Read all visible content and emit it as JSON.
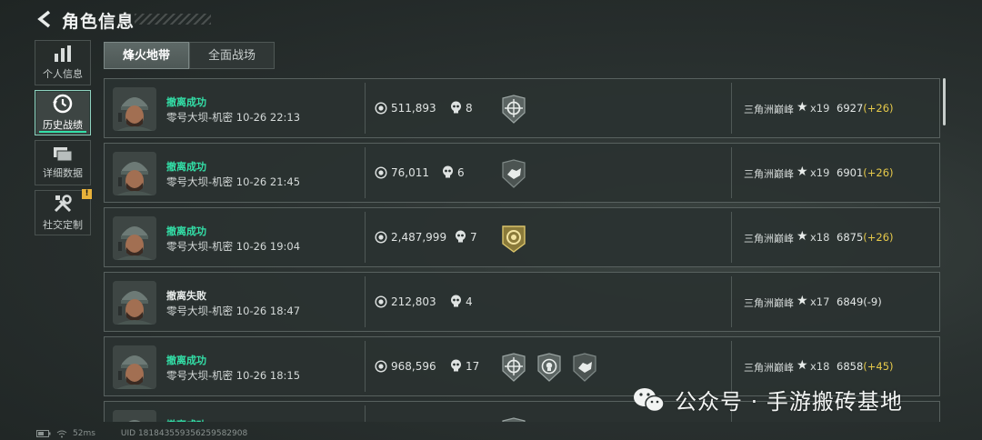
{
  "page": {
    "title": "角色信息"
  },
  "sidebar": {
    "items": [
      {
        "label": "个人信息",
        "icon": "bar-chart-icon",
        "active": false
      },
      {
        "label": "历史战绩",
        "icon": "history-clock-icon",
        "active": true
      },
      {
        "label": "详细数据",
        "icon": "folder-icon",
        "active": false
      },
      {
        "label": "社交定制",
        "icon": "tools-icon",
        "active": false,
        "badge": "!"
      }
    ]
  },
  "tabs": [
    {
      "label": "烽火地带",
      "active": true
    },
    {
      "label": "全面战场",
      "active": false
    }
  ],
  "matches": [
    {
      "status": "撤离成功",
      "result": "success",
      "map_time": "零号大坝-机密 10-26 22:13",
      "coins": "511,893",
      "kills": "8",
      "badges": [
        "shield-crosshair-badge"
      ],
      "rank": "三角洲巅峰",
      "stars": "x19",
      "score": "6927",
      "delta": "(+26)"
    },
    {
      "status": "撤离成功",
      "result": "success",
      "map_time": "零号大坝-机密 10-26 21:45",
      "coins": "76,011",
      "kills": "6",
      "badges": [
        "handshake-badge"
      ],
      "rank": "三角洲巅峰",
      "stars": "x19",
      "score": "6901",
      "delta": "(+26)"
    },
    {
      "status": "撤离成功",
      "result": "success",
      "map_time": "零号大坝-机密 10-26 19:04",
      "coins": "2,487,999",
      "kills": "7",
      "badges": [
        "gold-medal-badge"
      ],
      "rank": "三角洲巅峰",
      "stars": "x18",
      "score": "6875",
      "delta": "(+26)"
    },
    {
      "status": "撤离失败",
      "result": "fail",
      "map_time": "零号大坝-机密 10-26 18:47",
      "coins": "212,803",
      "kills": "4",
      "badges": [],
      "rank": "三角洲巅峰",
      "stars": "x17",
      "score": "6849",
      "delta": "(-9)"
    },
    {
      "status": "撤离成功",
      "result": "success",
      "map_time": "零号大坝-机密 10-26 18:15",
      "coins": "968,596",
      "kills": "17",
      "badges": [
        "shield-crosshair-badge",
        "shield-skull-badge",
        "handshake-badge"
      ],
      "rank": "三角洲巅峰",
      "stars": "x18",
      "score": "6858",
      "delta": "(+45)"
    },
    {
      "status": "撤离成功",
      "result": "success",
      "map_time": "",
      "coins": "",
      "kills": "",
      "badges": [
        "shield-crosshair-badge"
      ],
      "rank": "",
      "stars": "",
      "score": "",
      "delta": ""
    }
  ],
  "footer": {
    "ping": "52ms",
    "uid": "UID 181843559356259582908"
  },
  "watermark": {
    "text": "公众号 · 手游搬砖基地"
  },
  "colors": {
    "success": "#33e0a8",
    "delta_positive": "#e6c94a",
    "accent_active": "#8fd3c0"
  }
}
